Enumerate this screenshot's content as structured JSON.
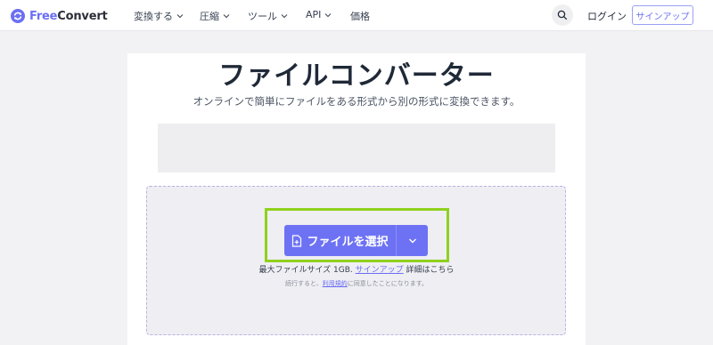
{
  "header": {
    "logo_free": "Free",
    "logo_convert": "Convert",
    "nav": [
      {
        "label": "変換する"
      },
      {
        "label": "圧縮"
      },
      {
        "label": "ツール"
      },
      {
        "label": "API"
      },
      {
        "label": "価格"
      }
    ],
    "login_label": "ログイン",
    "signup_label": "サインアップ"
  },
  "main": {
    "title": "ファイルコンバーター",
    "subtitle": "オンラインで簡単にファイルをある形式から別の形式に変換できます。"
  },
  "upload": {
    "choose_label": "ファイルを選択",
    "max_size_text": "最大ファイルサイズ 1GB.",
    "signup_link": "サインアップ",
    "details_text": "詳細はこちら",
    "terms_prefix": "続行すると、",
    "terms_link": "利用規約",
    "terms_suffix": "に同意したことになります。"
  },
  "colors": {
    "accent": "#6d72f4",
    "highlight": "#8fd11d"
  }
}
